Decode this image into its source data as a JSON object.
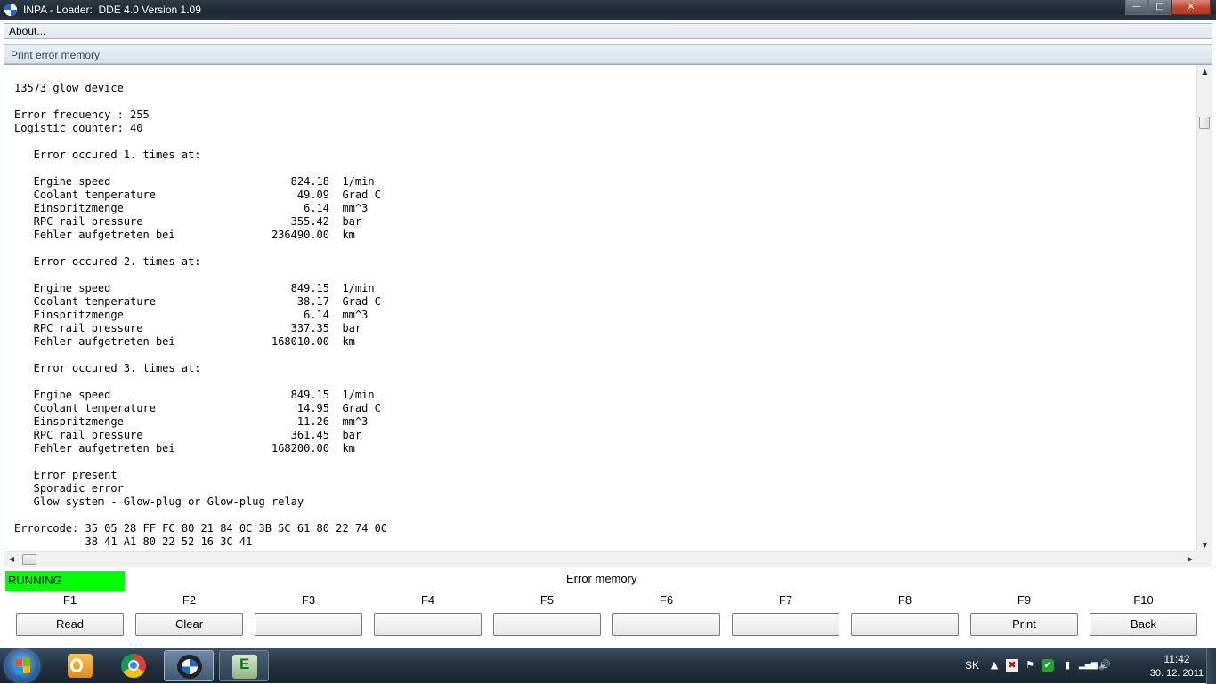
{
  "window": {
    "title": "INPA - Loader:  DDE 4.0 Version 1.09",
    "minimize_icon": "minimize-icon",
    "maximize_icon": "maximize-icon",
    "close_icon": "close-icon"
  },
  "menu": {
    "items": [
      "About..."
    ]
  },
  "caption": "Print error memory",
  "text_lines": [
    "13573 glow device",
    "",
    "Error frequency : 255",
    "Logistic counter: 40",
    "",
    "   Error occured 1. times at:",
    "",
    "   Engine speed                            824.18  1/min",
    "   Coolant temperature                      49.09  Grad C",
    "   Einspritzmenge                            6.14  mm^3",
    "   RPC rail pressure                       355.42  bar",
    "   Fehler aufgetreten bei               236490.00  km",
    "",
    "   Error occured 2. times at:",
    "",
    "   Engine speed                            849.15  1/min",
    "   Coolant temperature                      38.17  Grad C",
    "   Einspritzmenge                            6.14  mm^3",
    "   RPC rail pressure                       337.35  bar",
    "   Fehler aufgetreten bei               168010.00  km",
    "",
    "   Error occured 3. times at:",
    "",
    "   Engine speed                            849.15  1/min",
    "   Coolant temperature                      14.95  Grad C",
    "   Einspritzmenge                           11.26  mm^3",
    "   RPC rail pressure                       361.45  bar",
    "   Fehler aufgetreten bei               168200.00  km",
    "",
    "   Error present",
    "   Sporadic error",
    "   Glow system - Glow-plug or Glow-plug relay",
    "",
    "Errorcode: 35 05 28 FF FC 80 21 84 0C 3B 5C 61 80 22 74 0C",
    "           38 41 A1 80 22 52 16 3C 41"
  ],
  "status": {
    "text": "RUNNING",
    "color": "#00ff00"
  },
  "screen_title": "Error memory",
  "function_keys": [
    {
      "key": "F1",
      "label": "Read"
    },
    {
      "key": "F2",
      "label": "Clear"
    },
    {
      "key": "F3",
      "label": ""
    },
    {
      "key": "F4",
      "label": ""
    },
    {
      "key": "F5",
      "label": ""
    },
    {
      "key": "F6",
      "label": ""
    },
    {
      "key": "F7",
      "label": ""
    },
    {
      "key": "F8",
      "label": ""
    },
    {
      "key": "F9",
      "label": "Print"
    },
    {
      "key": "F10",
      "label": "Back"
    }
  ],
  "taskbar": {
    "apps": [
      "windows-start-icon",
      "outlook-icon",
      "chrome-icon",
      "bmw-inpa-icon",
      "ediabas-icon"
    ],
    "tray": {
      "language": "SK",
      "time": "11:42",
      "date": "30. 12. 2011"
    }
  }
}
